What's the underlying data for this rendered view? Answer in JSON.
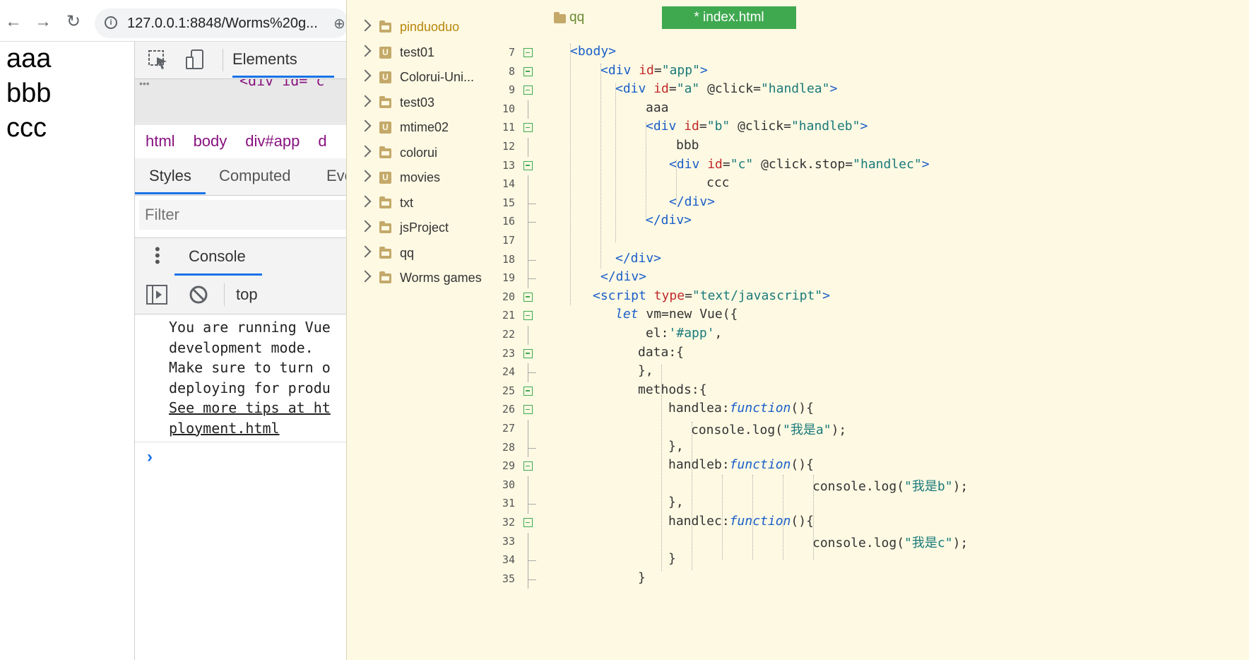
{
  "browser": {
    "url": "127.0.0.1:8848/Worms%20g...",
    "page_lines": [
      "aaa",
      "bbb",
      "ccc"
    ],
    "devtools": {
      "tab_elements": "Elements",
      "dom_snippet": "<div id=\"c\" ",
      "breadcrumbs": [
        "html",
        "body",
        "div#app",
        "d"
      ],
      "style_tabs": [
        "Styles",
        "Computed",
        "Eve"
      ],
      "filter_placeholder": "Filter",
      "console_tab": "Console",
      "context": "top",
      "console_lines": [
        "You are running Vue",
        "development mode.",
        "Make sure to turn o",
        "deploying for produ",
        "See more tips at ht",
        "ployment.html"
      ],
      "prompt": "›"
    }
  },
  "filetree": {
    "items": [
      {
        "label": "pinduoduo",
        "icon": "folder-icon",
        "active": true
      },
      {
        "label": "test01",
        "icon": "uniapp-project-icon"
      },
      {
        "label": "Colorui-Uni...",
        "icon": "uniapp-project-icon"
      },
      {
        "label": "test03",
        "icon": "folder-icon"
      },
      {
        "label": "mtime02",
        "icon": "uniapp-project-icon"
      },
      {
        "label": "colorui",
        "icon": "folder-icon"
      },
      {
        "label": "movies",
        "icon": "uniapp-project-icon"
      },
      {
        "label": "txt",
        "icon": "folder-icon"
      },
      {
        "label": "jsProject",
        "icon": "folder-icon"
      },
      {
        "label": "qq",
        "icon": "folder-icon"
      },
      {
        "label": "Worms games",
        "icon": "folder-icon"
      }
    ]
  },
  "editor": {
    "project": "qq",
    "tab": "* index.html",
    "colors": {
      "tab_bg": "#3fa950",
      "background": "#fdf9e3",
      "tag": "#1a5ec9",
      "attr": "#c02a2a",
      "string": "#1a7a7a"
    },
    "lines": [
      {
        "n": "7",
        "fold": "box",
        "html": "<span class=\"t\">&lt;body&gt;</span>"
      },
      {
        "n": "8",
        "fold": "box",
        "html": "<span class=\"t\">&lt;div</span> <span class=\"a\">id</span>=<span class=\"s\">\"app\"</span><span class=\"t\">&gt;</span>"
      },
      {
        "n": "9",
        "fold": "box",
        "html": "<span class=\"t\">&lt;div</span> <span class=\"a\">id</span>=<span class=\"s\">\"a\"</span> @click=<span class=\"s\">\"handlea\"</span><span class=\"t\">&gt;</span>"
      },
      {
        "n": "10",
        "fold": "line",
        "html": "aaa"
      },
      {
        "n": "11",
        "fold": "box",
        "html": "<span class=\"t\">&lt;div</span> <span class=\"a\">id</span>=<span class=\"s\">\"b\"</span> @click=<span class=\"s\">\"handleb\"</span><span class=\"t\">&gt;</span>"
      },
      {
        "n": "12",
        "fold": "line",
        "html": "bbb"
      },
      {
        "n": "13",
        "fold": "box",
        "html": "<span class=\"t\">&lt;div</span> <span class=\"a\">id</span>=<span class=\"s\">\"c\"</span> @click.stop=<span class=\"s\">\"handlec\"</span><span class=\"t\">&gt;</span>"
      },
      {
        "n": "14",
        "fold": "line",
        "html": "ccc"
      },
      {
        "n": "15",
        "fold": "end",
        "html": "<span class=\"t\">&lt;/div&gt;</span>"
      },
      {
        "n": "16",
        "fold": "end",
        "html": "<span class=\"t\">&lt;/div&gt;</span>"
      },
      {
        "n": "17",
        "fold": "line",
        "html": ""
      },
      {
        "n": "18",
        "fold": "end",
        "html": "<span class=\"t\">&lt;/div&gt;</span>"
      },
      {
        "n": "19",
        "fold": "end",
        "html": "<span class=\"t\">&lt;/div&gt;</span>"
      },
      {
        "n": "20",
        "fold": "box",
        "html": "<span class=\"t\">&lt;script</span> <span class=\"a\">type</span>=<span class=\"s\">\"text/javascript\"</span><span class=\"t\">&gt;</span>"
      },
      {
        "n": "21",
        "fold": "box",
        "html": "<span class=\"k\">let</span> vm=new Vue({"
      },
      {
        "n": "22",
        "fold": "line",
        "html": "el:<span class=\"s\">'#app'</span>,"
      },
      {
        "n": "23",
        "fold": "box",
        "html": "data:{"
      },
      {
        "n": "24",
        "fold": "end",
        "html": "},"
      },
      {
        "n": "25",
        "fold": "box",
        "html": "methods:{"
      },
      {
        "n": "26",
        "fold": "box",
        "html": "handlea:<span class=\"k\">function</span>(){"
      },
      {
        "n": "27",
        "fold": "line",
        "html": "console.log(<span class=\"s\">\"我是a\"</span>);"
      },
      {
        "n": "28",
        "fold": "end",
        "html": "},"
      },
      {
        "n": "29",
        "fold": "box",
        "html": "handleb:<span class=\"k\">function</span>(){"
      },
      {
        "n": "30",
        "fold": "line",
        "html": "console.log(<span class=\"s\">\"我是b\"</span>);"
      },
      {
        "n": "31",
        "fold": "end",
        "html": "},"
      },
      {
        "n": "32",
        "fold": "box",
        "html": "handlec:<span class=\"k\">function</span>(){"
      },
      {
        "n": "33",
        "fold": "line",
        "html": "console.log(<span class=\"s\">\"我是c\"</span>);"
      },
      {
        "n": "34",
        "fold": "end",
        "html": "}"
      },
      {
        "n": "35",
        "fold": "end",
        "html": "}"
      }
    ]
  }
}
